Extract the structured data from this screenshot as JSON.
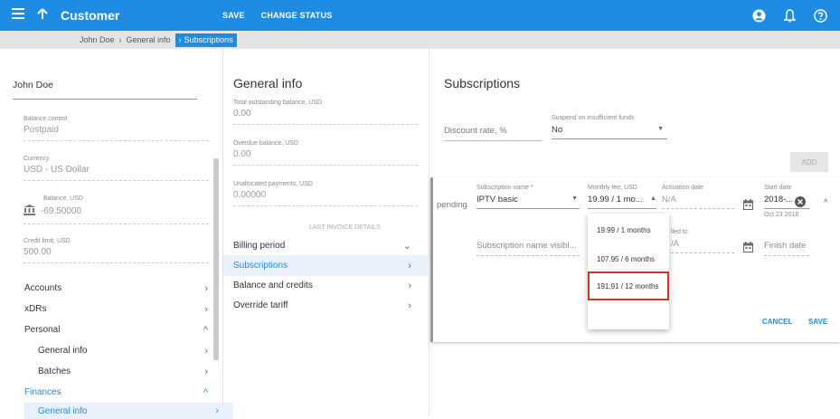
{
  "topbar": {
    "title": "Customer",
    "save_label": "SAVE",
    "change_status_label": "CHANGE STATUS"
  },
  "breadcrumb": {
    "items": [
      "John Doe",
      "General info",
      "Subscriptions"
    ]
  },
  "customer": {
    "name": "John Doe",
    "fields": [
      {
        "label": "Balance control",
        "value": "Postpaid"
      },
      {
        "label": "Currency",
        "value": "USD - US Dollar"
      },
      {
        "label": "Balance, USD",
        "value": "-69.50000"
      },
      {
        "label": "Credit limit, USD",
        "value": "500.00"
      }
    ],
    "menu": [
      {
        "label": "Accounts",
        "chev": "›"
      },
      {
        "label": "xDRs",
        "chev": "›"
      },
      {
        "label": "Personal",
        "chev": "^"
      },
      {
        "label": "General info",
        "chev": "›"
      },
      {
        "label": "Batches",
        "chev": "›"
      },
      {
        "label": "Finances",
        "chev": "^"
      },
      {
        "label": "General info",
        "chev": "›"
      }
    ]
  },
  "general_info": {
    "title": "General info",
    "fields": [
      {
        "label": "Total outstanding balance, USD",
        "value": "0.00"
      },
      {
        "label": "Overdue balance, USD",
        "value": "0.00"
      },
      {
        "label": "Unallocated payments, USD",
        "value": "0.00000"
      }
    ],
    "last_invoice_label": "LAST INVOICE DETAILS",
    "sections": [
      {
        "label": "Billing period",
        "chev": "⌄"
      },
      {
        "label": "Subscriptions",
        "chev": "›"
      },
      {
        "label": "Balance and credits",
        "chev": "›"
      },
      {
        "label": "Override tariff",
        "chev": "›"
      }
    ]
  },
  "subscriptions": {
    "title": "Subscriptions",
    "discount_placeholder": "Discount rate, %",
    "suspend_label": "Suspend on insufficient funds",
    "suspend_value": "No",
    "add_label": "ADD",
    "row": {
      "status": "pending",
      "name_label": "Subscription name *",
      "name_value": "IPTV basic",
      "fee_label": "Monthly fee, USD",
      "fee_value": "19.99 / 1 mo...",
      "activation_label": "Activation date",
      "activation_value": "N/A",
      "start_label": "Start date",
      "start_value": "2018-...",
      "start_hint": "Oct 23 2018",
      "visible_placeholder": "Subscription name visibl...",
      "billed_label": "lled to",
      "billed_value": "/A",
      "finish_placeholder": "Finish date",
      "cancel_label": "CANCEL",
      "save_label": "SAVE"
    },
    "fee_options": [
      "19.99 / 1 months",
      "107.95 / 6 months",
      "191.91 / 12 months"
    ],
    "selected_option_index": 2
  },
  "colors": {
    "accent": "#1f8ce4",
    "highlight": "#c0392b"
  }
}
